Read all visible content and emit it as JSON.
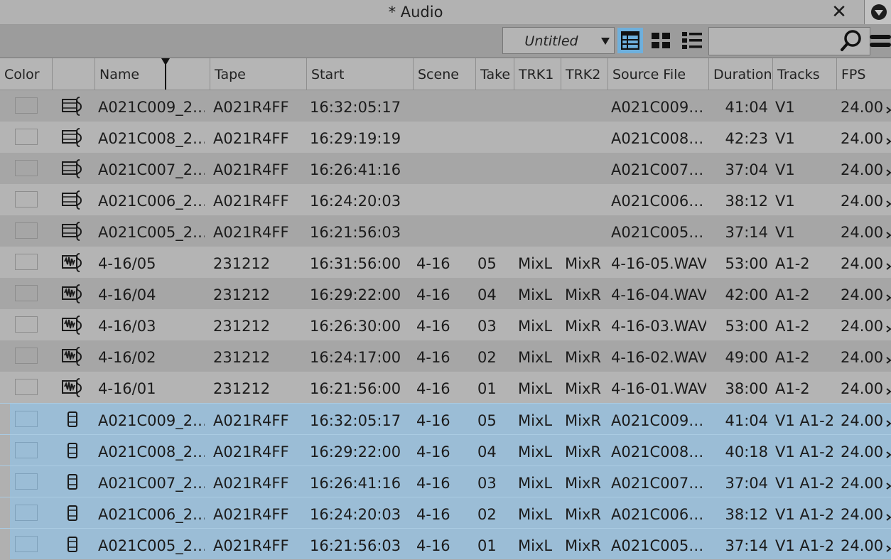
{
  "window": {
    "title": "* Audio"
  },
  "toolbar": {
    "view_name": "Untitled",
    "search_value": ""
  },
  "columns": [
    "Color",
    "",
    "Name",
    "Tape",
    "Start",
    "Scene",
    "Take",
    "TRK1",
    "TRK2",
    "Source File",
    "Duration",
    "Tracks",
    "FPS"
  ],
  "rows": [
    {
      "icon": "sequence-clip-icon",
      "name": "A021C009_2…",
      "tape": "A021R4FF",
      "start": "16:32:05:17",
      "scene": "",
      "take": "",
      "trk1": "",
      "trk2": "",
      "source": "A021C009…",
      "duration": "41:04",
      "tracks": "V1",
      "fps": "24.00",
      "selected": false
    },
    {
      "icon": "sequence-clip-icon",
      "name": "A021C008_2…",
      "tape": "A021R4FF",
      "start": "16:29:19:19",
      "scene": "",
      "take": "",
      "trk1": "",
      "trk2": "",
      "source": "A021C008…",
      "duration": "42:23",
      "tracks": "V1",
      "fps": "24.00",
      "selected": false
    },
    {
      "icon": "sequence-clip-icon",
      "name": "A021C007_2…",
      "tape": "A021R4FF",
      "start": "16:26:41:16",
      "scene": "",
      "take": "",
      "trk1": "",
      "trk2": "",
      "source": "A021C007…",
      "duration": "37:04",
      "tracks": "V1",
      "fps": "24.00",
      "selected": false
    },
    {
      "icon": "sequence-clip-icon",
      "name": "A021C006_2…",
      "tape": "A021R4FF",
      "start": "16:24:20:03",
      "scene": "",
      "take": "",
      "trk1": "",
      "trk2": "",
      "source": "A021C006…",
      "duration": "38:12",
      "tracks": "V1",
      "fps": "24.00",
      "selected": false
    },
    {
      "icon": "sequence-clip-icon",
      "name": "A021C005_2…",
      "tape": "A021R4FF",
      "start": "16:21:56:03",
      "scene": "",
      "take": "",
      "trk1": "",
      "trk2": "",
      "source": "A021C005…",
      "duration": "37:14",
      "tracks": "V1",
      "fps": "24.00",
      "selected": false
    },
    {
      "icon": "audio-clip-icon",
      "name": "4-16/05",
      "tape": "231212",
      "start": "16:31:56:00",
      "scene": "4-16",
      "take": "05",
      "trk1": "MixL",
      "trk2": "MixR",
      "source": "4-16-05.WAV",
      "duration": "53:00",
      "tracks": "A1-2",
      "fps": "24.00",
      "selected": false
    },
    {
      "icon": "audio-clip-icon",
      "name": "4-16/04",
      "tape": "231212",
      "start": "16:29:22:00",
      "scene": "4-16",
      "take": "04",
      "trk1": "MixL",
      "trk2": "MixR",
      "source": "4-16-04.WAV",
      "duration": "42:00",
      "tracks": "A1-2",
      "fps": "24.00",
      "selected": false
    },
    {
      "icon": "audio-clip-icon",
      "name": "4-16/03",
      "tape": "231212",
      "start": "16:26:30:00",
      "scene": "4-16",
      "take": "03",
      "trk1": "MixL",
      "trk2": "MixR",
      "source": "4-16-03.WAV",
      "duration": "53:00",
      "tracks": "A1-2",
      "fps": "24.00",
      "selected": false
    },
    {
      "icon": "audio-clip-icon",
      "name": "4-16/02",
      "tape": "231212",
      "start": "16:24:17:00",
      "scene": "4-16",
      "take": "02",
      "trk1": "MixL",
      "trk2": "MixR",
      "source": "4-16-02.WAV",
      "duration": "49:00",
      "tracks": "A1-2",
      "fps": "24.00",
      "selected": false
    },
    {
      "icon": "audio-clip-icon",
      "name": "4-16/01",
      "tape": "231212",
      "start": "16:21:56:00",
      "scene": "4-16",
      "take": "01",
      "trk1": "MixL",
      "trk2": "MixR",
      "source": "4-16-01.WAV",
      "duration": "38:00",
      "tracks": "A1-2",
      "fps": "24.00",
      "selected": false
    },
    {
      "icon": "synced-clip-icon",
      "name": "A021C009_2…",
      "tape": "A021R4FF",
      "start": "16:32:05:17",
      "scene": "4-16",
      "take": "05",
      "trk1": "MixL",
      "trk2": "MixR",
      "source": "A021C009…",
      "duration": "41:04",
      "tracks": "V1 A1-2",
      "fps": "24.00",
      "selected": true
    },
    {
      "icon": "synced-clip-icon",
      "name": "A021C008_2…",
      "tape": "A021R4FF",
      "start": "16:29:22:00",
      "scene": "4-16",
      "take": "04",
      "trk1": "MixL",
      "trk2": "MixR",
      "source": "A021C008…",
      "duration": "40:18",
      "tracks": "V1 A1-2",
      "fps": "24.00",
      "selected": true
    },
    {
      "icon": "synced-clip-icon",
      "name": "A021C007_2…",
      "tape": "A021R4FF",
      "start": "16:26:41:16",
      "scene": "4-16",
      "take": "03",
      "trk1": "MixL",
      "trk2": "MixR",
      "source": "A021C007…",
      "duration": "37:04",
      "tracks": "V1 A1-2",
      "fps": "24.00",
      "selected": true
    },
    {
      "icon": "synced-clip-icon",
      "name": "A021C006_2…",
      "tape": "A021R4FF",
      "start": "16:24:20:03",
      "scene": "4-16",
      "take": "02",
      "trk1": "MixL",
      "trk2": "MixR",
      "source": "A021C006…",
      "duration": "38:12",
      "tracks": "V1 A1-2",
      "fps": "24.00",
      "selected": true
    },
    {
      "icon": "synced-clip-icon",
      "name": "A021C005_2…",
      "tape": "A021R4FF",
      "start": "16:21:56:03",
      "scene": "4-16",
      "take": "01",
      "trk1": "MixL",
      "trk2": "MixR",
      "source": "A021C005…",
      "duration": "37:14",
      "tracks": "V1 A1-2",
      "fps": "24.00",
      "selected": true
    }
  ],
  "colors": {
    "selection": "#9bbdd6",
    "active_view": "#6eb0dd"
  }
}
